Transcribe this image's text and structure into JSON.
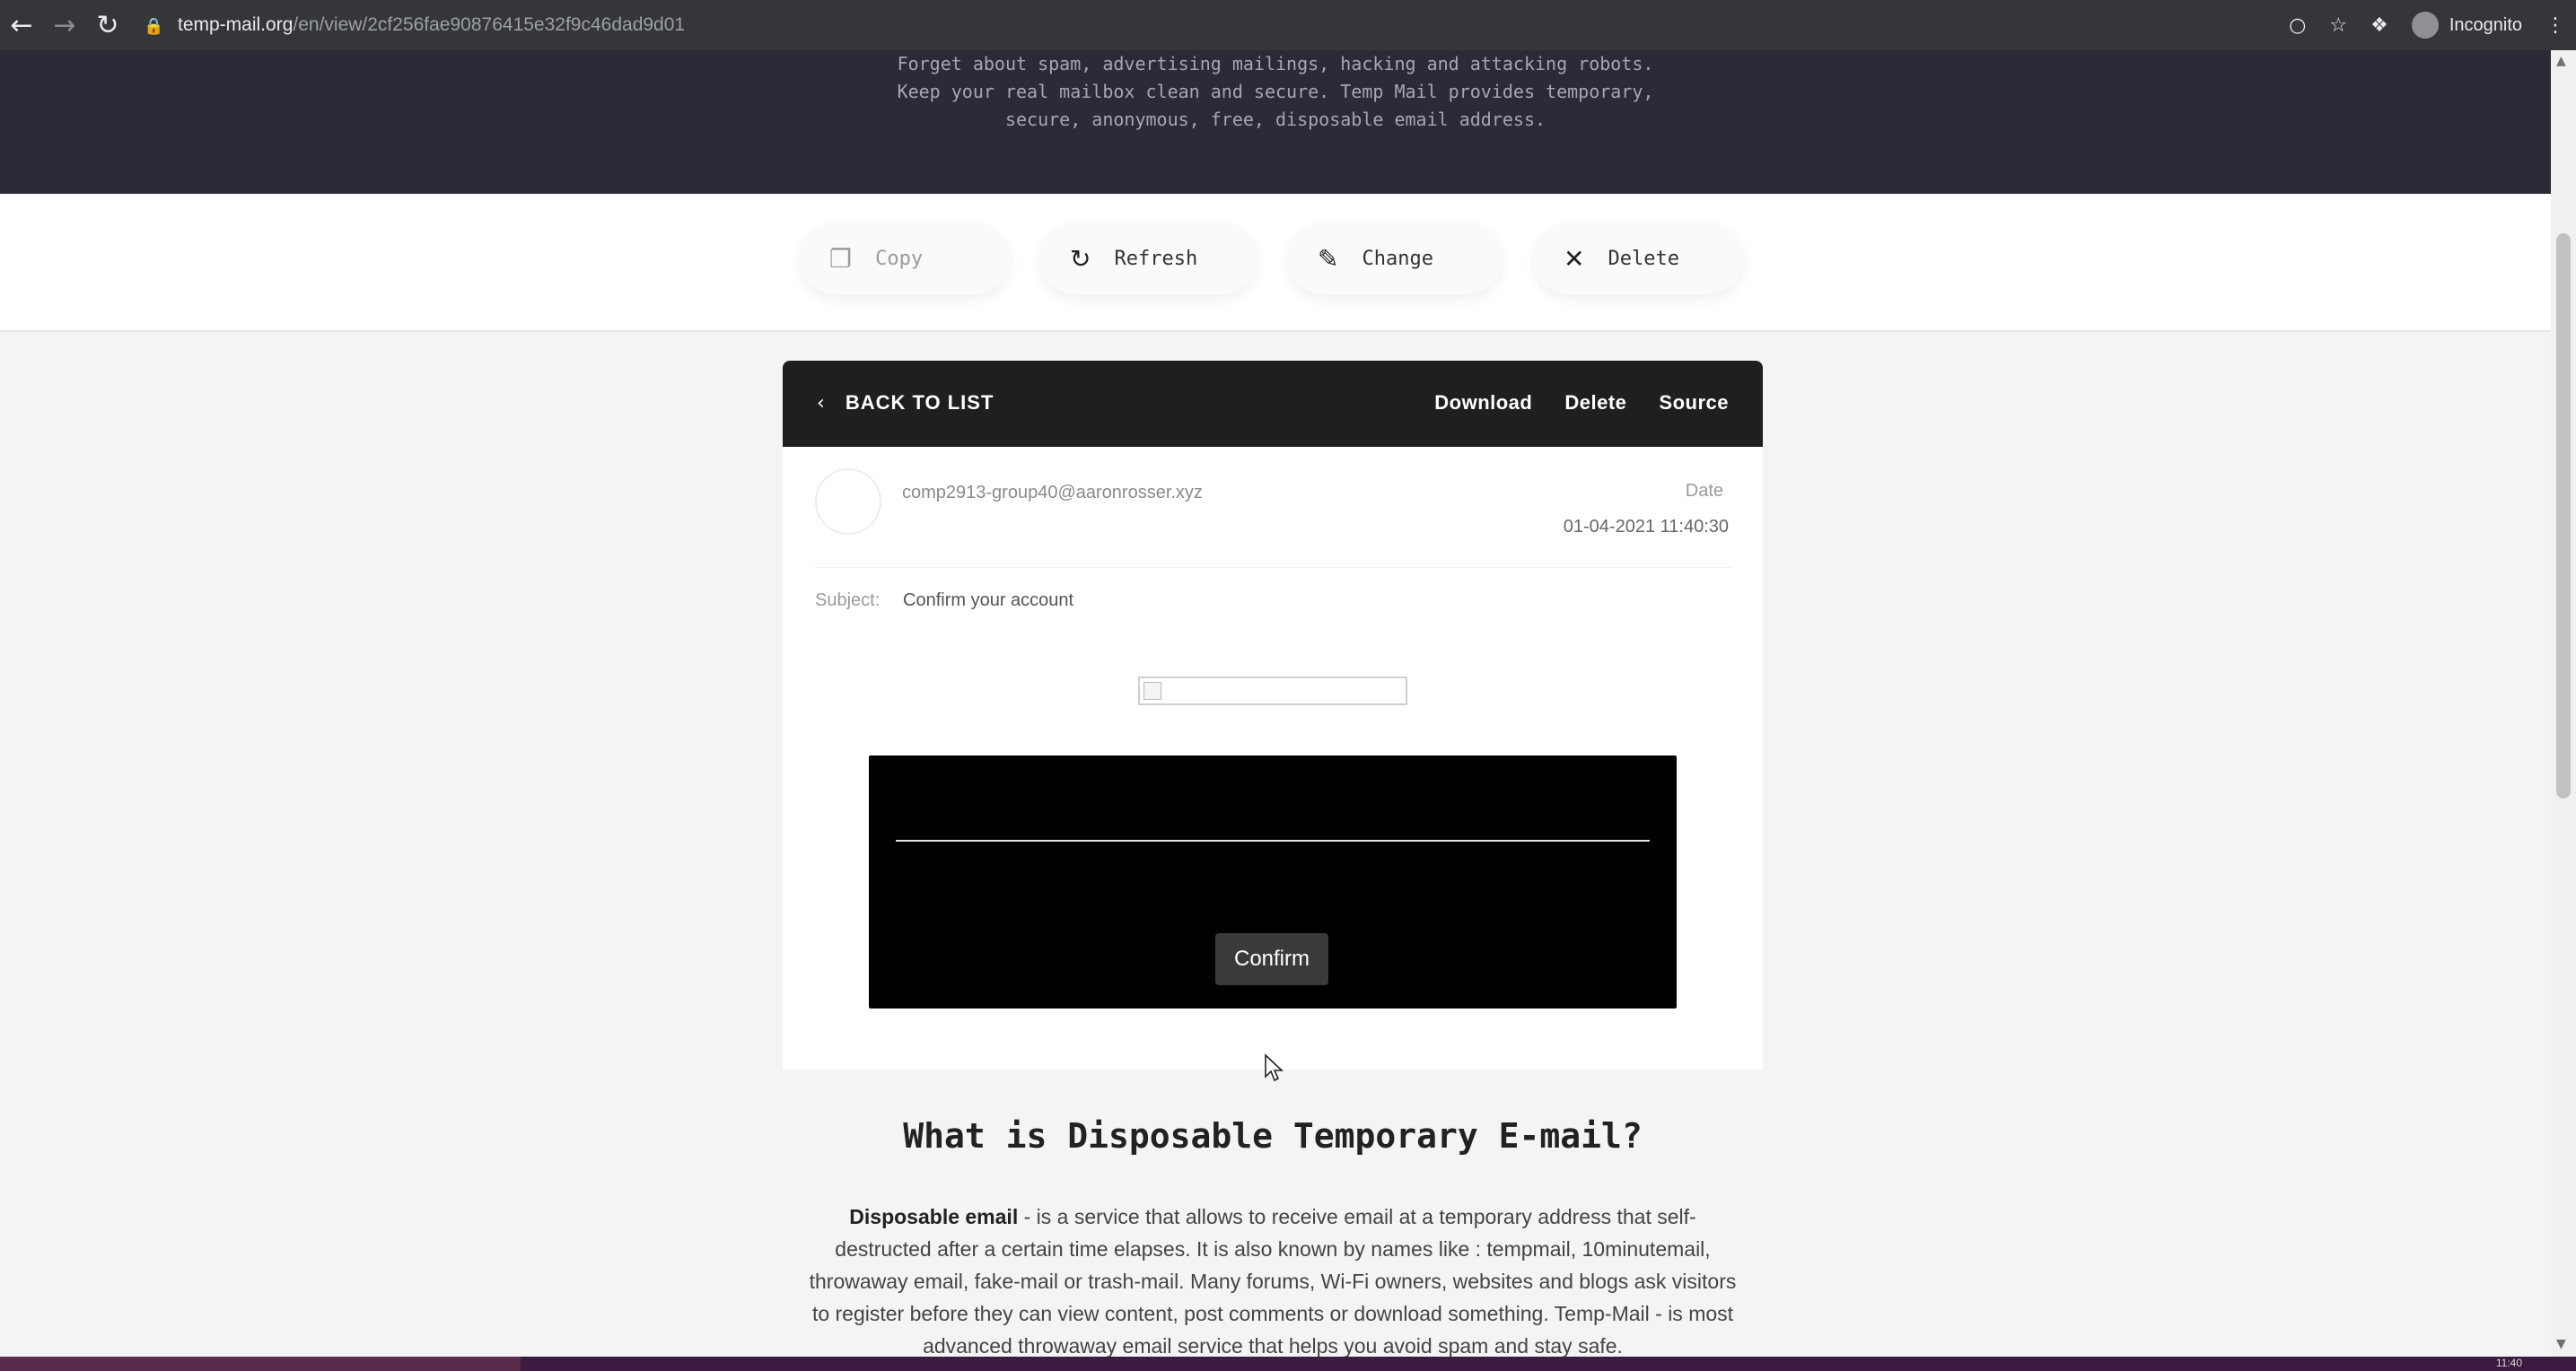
{
  "browser": {
    "url_domain": "temp-mail.org",
    "url_path": "/en/view/2cf256fae90876415e32f9c46dad9d01",
    "profile_label": "Incognito"
  },
  "hero": {
    "line1": "Forget about spam, advertising mailings, hacking and attacking robots.",
    "line2": "Keep your real mailbox clean and secure. Temp Mail provides temporary,",
    "line3": "secure, anonymous, free, disposable email address."
  },
  "toolbar": {
    "copy": "Copy",
    "refresh": "Refresh",
    "change": "Change",
    "delete": "Delete"
  },
  "email": {
    "back_label": "BACK TO LIST",
    "actions": {
      "download": "Download",
      "delete": "Delete",
      "source": "Source"
    },
    "sender": "comp2913-group40@aaronrosser.xyz",
    "date_label": "Date",
    "date_value": "01-04-2021 11:40:30",
    "subject_label": "Subject:",
    "subject_value": "Confirm your account",
    "confirm_label": "Confirm"
  },
  "info": {
    "title": "What is Disposable Temporary E-mail?",
    "bold_lead": "Disposable email",
    "line1_rest": " - is a service that allows to receive email at a temporary address that self-",
    "line2": "destructed after a certain time elapses. It is also known by names like : tempmail, 10minutemail,",
    "line3": "throwaway email, fake-mail or trash-mail. Many forums, Wi-Fi owners, websites and blogs ask visitors",
    "line4": "to register before they can view content, post comments or download something. Temp-Mail - is most",
    "line5": "advanced throwaway email service that helps you avoid spam and stay safe."
  },
  "taskbar": {
    "clock": "11:40"
  },
  "icons": {
    "back": "back-arrow-icon",
    "forward": "forward-arrow-icon",
    "reload": "reload-icon",
    "lock": "lock-icon",
    "eye_off": "eye-off-icon",
    "star": "star-icon",
    "extensions": "puzzle-icon",
    "menu": "kebab-menu-icon"
  },
  "colors": {
    "hero_bg": "#2b2b38",
    "email_header_bg": "#1f1f22",
    "confirm_bg": "#3a3a3a"
  }
}
